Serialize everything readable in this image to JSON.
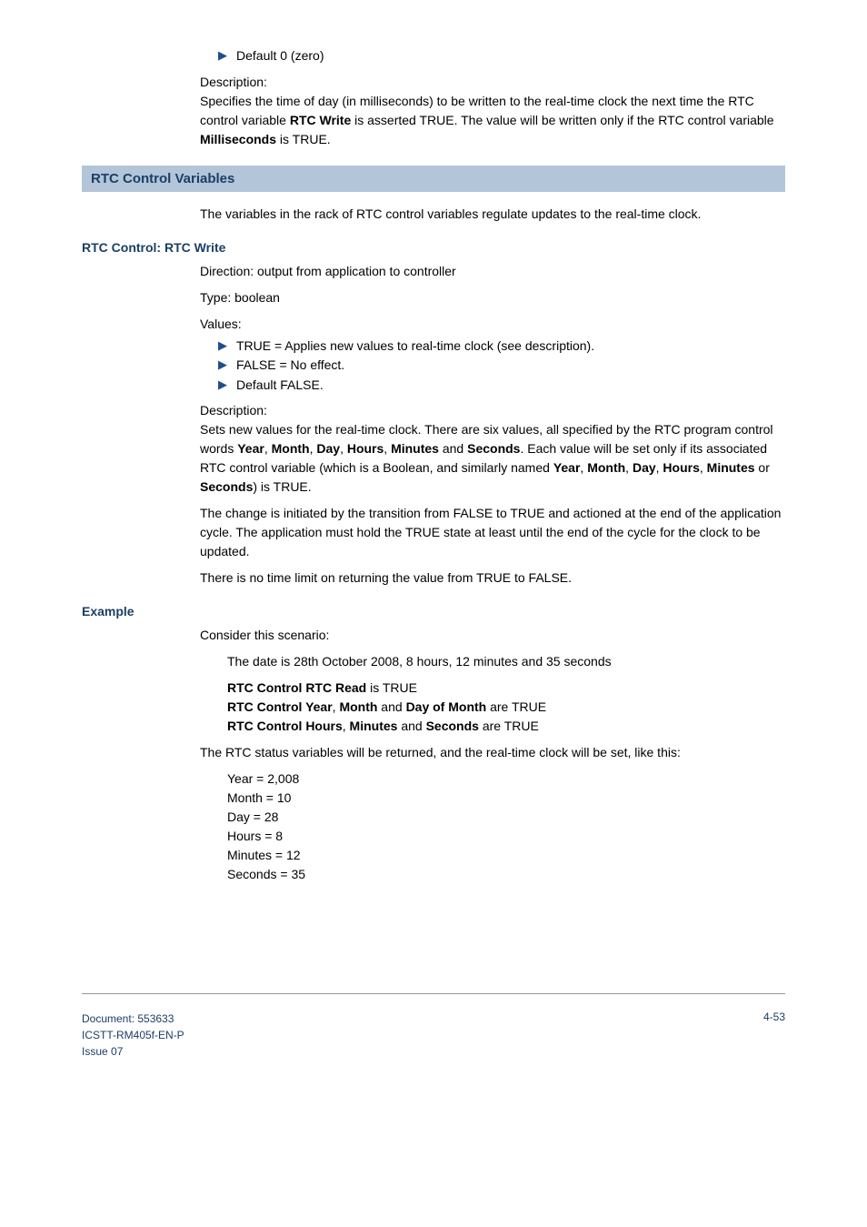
{
  "top_bullet": "Default 0 (zero)",
  "desc_label": "Description:",
  "desc_top": "Specifies the time of day (in milliseconds) to be written to the real-time clock the next time the RTC control variable ",
  "desc_top_bold1": "RTC Write",
  "desc_top_mid": " is asserted TRUE. The value will be written only if the RTC control variable ",
  "desc_top_bold2": "Milliseconds",
  "desc_top_end": " is TRUE.",
  "band": "RTC Control Variables",
  "band_para": "The variables in the rack of RTC control variables regulate updates to the real-time clock.",
  "sub1": "RTC Control: RTC Write",
  "dir": "Direction: output from application to controller",
  "type": "Type: boolean",
  "values_label": "Values:",
  "val1": "TRUE = Applies new values to real-time clock (see description).",
  "val2": "FALSE = No effect.",
  "val3": "Default FALSE.",
  "desc2_p1a": "Sets new values for the real-time clock. There are six values, all specified by the RTC program control words ",
  "year": "Year",
  "month": "Month",
  "day": "Day",
  "hours": "Hours",
  "minutes": "Minutes",
  "seconds": "Seconds",
  "comma": ", ",
  "and": " and ",
  "or": " or ",
  "desc2_p1b": ". Each value will be set only if its associated RTC control variable (which is a Boolean, and similarly named ",
  "desc2_p1c": ") is TRUE.",
  "desc2_p2": "The change is initiated by the transition from FALSE to TRUE and actioned at the end of the application cycle. The application must hold the TRUE state at least until the end of the cycle for the clock to be updated.",
  "desc2_p3": "There is no time limit on returning the value from TRUE to FALSE.",
  "example_head": "Example",
  "example_intro": "Consider this scenario:",
  "example_date": "The date is 28th October 2008, 8 hours, 12 minutes and 35 seconds",
  "ex_line1a": "RTC Control RTC Read",
  "ex_line1b": " is TRUE",
  "ex_line2a": "RTC Control Year",
  "ex_line2c": "Day of Month",
  "ex_line2d": " are TRUE",
  "ex_line3a": "RTC Control Hours",
  "ex_line3d": " are TRUE",
  "result_intro": "The RTC status variables will be returned, and the real-time clock will be set, like this:",
  "res1": "Year = 2,008",
  "res2": "Month = 10",
  "res3": "Day = 28",
  "res4": "Hours = 8",
  "res5": "Minutes = 12",
  "res6": "Seconds = 35",
  "footer_doc": "Document: 553633",
  "footer_code": "ICSTT-RM405f-EN-P",
  "footer_issue": "Issue 07",
  "footer_page": "4-53"
}
